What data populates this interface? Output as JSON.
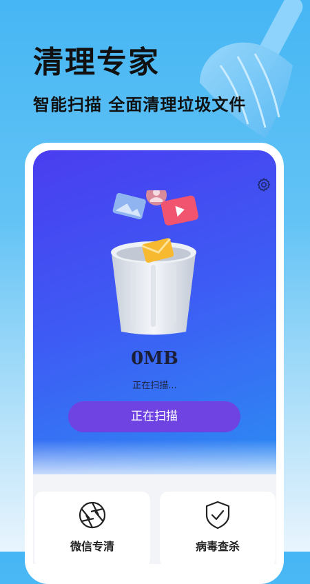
{
  "header": {
    "title": "清理专家",
    "subtitle": "智能扫描 全面清理垃圾文件"
  },
  "scan": {
    "size_value": "0MB",
    "status_text": "正在扫描...",
    "button_label": "正在扫描"
  },
  "features": [
    {
      "label": "微信专清",
      "icon": "wechat-shutter-icon"
    },
    {
      "label": "病毒查杀",
      "icon": "shield-check-icon"
    }
  ],
  "colors": {
    "background_top": "#46b6f4",
    "screen_gradient_start": "#4a3df0",
    "screen_gradient_end": "#2b9ef2",
    "button": "#6e43e2",
    "title_text": "#111111"
  }
}
